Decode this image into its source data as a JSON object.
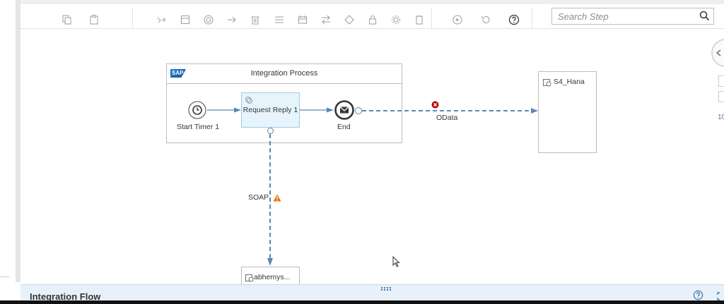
{
  "toolbar": {
    "icons": [
      "copy-icon",
      "paste-icon",
      "connector-icon",
      "container-icon",
      "events-icon",
      "call-icon",
      "delete-icon",
      "messaging-icon",
      "transform-icon",
      "routing-icon",
      "gateway-icon",
      "security-icon",
      "persistence-icon",
      "validator-icon",
      "run-icon",
      "undo-icon",
      "help-icon"
    ]
  },
  "search": {
    "placeholder": "Search Step"
  },
  "process": {
    "pool_title": "Integration Process",
    "logo": "SAP",
    "start_label": "Start Timer 1",
    "task_label": "Request Reply 1",
    "end_label": "End"
  },
  "receivers": {
    "s4_label": "S4_Hana",
    "soap_receiver_label": "abhemys..."
  },
  "connections": {
    "odata_label": "OData",
    "soap_label": "SOAP"
  },
  "zoom": {
    "level": "10"
  },
  "bottom": {
    "title": "Integration Flow"
  },
  "colors": {
    "accent": "#427cac",
    "task_fill": "#e8f4fb",
    "error": "#bb0000",
    "warning": "#e9730c",
    "bottom_bar": "#e8f1fa"
  }
}
